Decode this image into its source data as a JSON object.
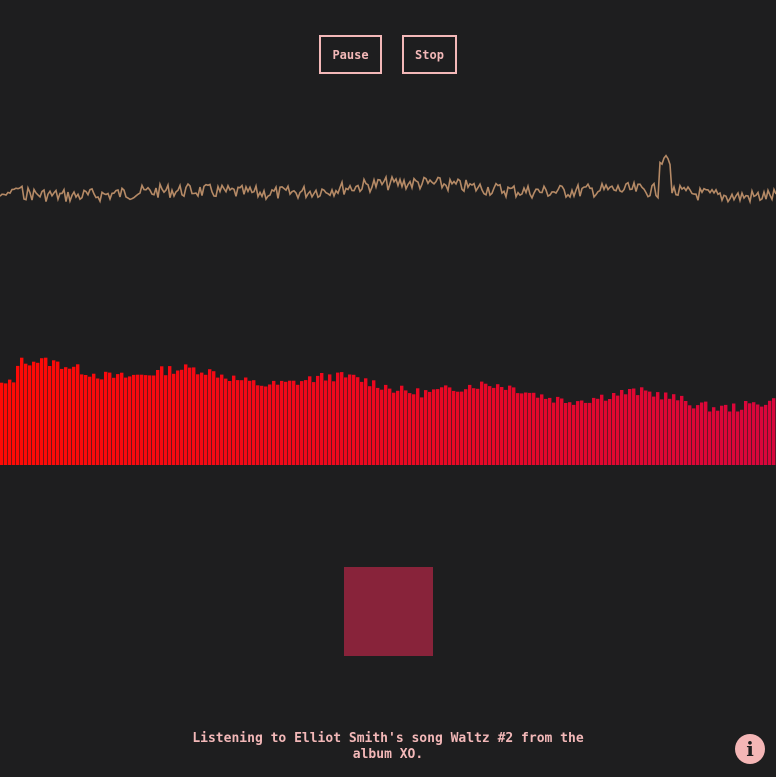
{
  "controls": {
    "pause_label": "Pause",
    "stop_label": "Stop"
  },
  "caption": {
    "text": "Listening to Elliot Smith's song Waltz #2 from the album XO."
  },
  "info": {
    "icon": "info-icon",
    "glyph": "i"
  },
  "colors": {
    "background": "#1e1e1f",
    "accent": "#f3b8b8",
    "waveform": "#b58a66",
    "spectrum_start": "#ff0a05",
    "spectrum_end": "#d9063c",
    "square": "#88233a"
  }
}
